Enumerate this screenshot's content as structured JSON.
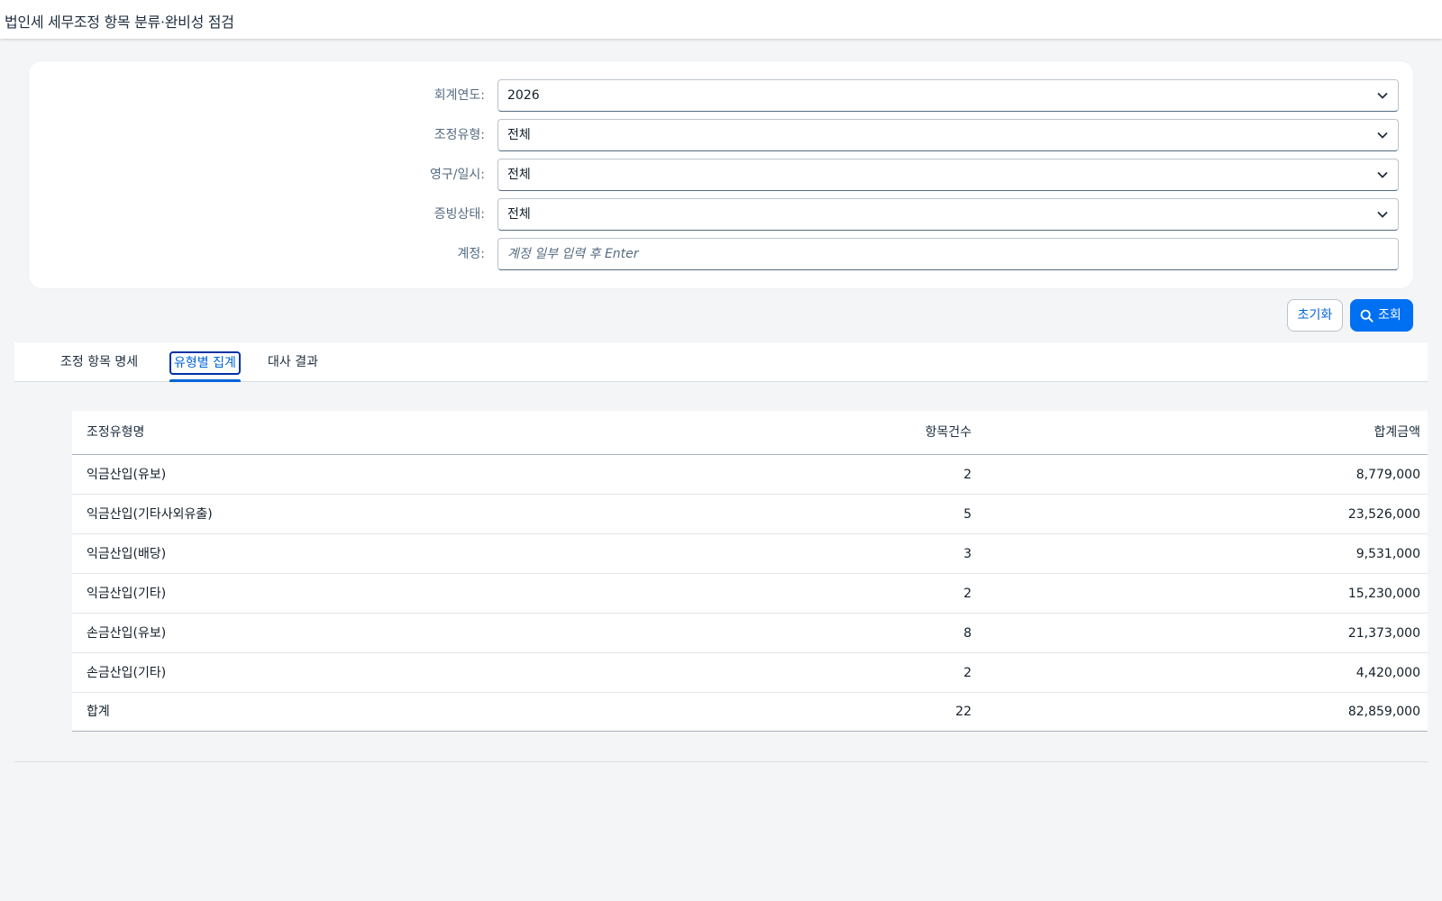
{
  "app": {
    "title": "법인세 세무조정 항목 분류·완비성 점검"
  },
  "filters": {
    "fiscal_year": {
      "label": "회계연도:",
      "value": "2026"
    },
    "adjustment_type": {
      "label": "조정유형:",
      "value": "전체"
    },
    "permanence": {
      "label": "영구/일시:",
      "value": "전체"
    },
    "evidence_status": {
      "label": "증빙상태:",
      "value": "전체"
    },
    "account": {
      "label": "계정:",
      "value": "",
      "placeholder": "계정 일부 입력 후 Enter"
    }
  },
  "actions": {
    "reset_label": "초기화",
    "search_label": "조회"
  },
  "tabs": [
    {
      "label": "조정 항목 명세",
      "selected": false
    },
    {
      "label": "유형별 집계",
      "selected": true
    },
    {
      "label": "대사 결과",
      "selected": false
    }
  ],
  "summary_table": {
    "columns": {
      "name": "조정유형명",
      "count": "항목건수",
      "amount": "합계금액"
    },
    "rows": [
      {
        "name": "익금산입(유보)",
        "count": "2",
        "amount": "8,779,000"
      },
      {
        "name": "익금산입(기타사외유출)",
        "count": "5",
        "amount": "23,526,000"
      },
      {
        "name": "익금산입(배당)",
        "count": "3",
        "amount": "9,531,000"
      },
      {
        "name": "익금산입(기타)",
        "count": "2",
        "amount": "15,230,000"
      },
      {
        "name": "손금산입(유보)",
        "count": "8",
        "amount": "21,373,000"
      },
      {
        "name": "손금산입(기타)",
        "count": "2",
        "amount": "4,420,000"
      }
    ],
    "total": {
      "name": "합계",
      "count": "22",
      "amount": "82,859,000"
    }
  },
  "colors": {
    "accent": "#0070f2",
    "link": "#0064d9",
    "background": "#f4f5f7"
  }
}
